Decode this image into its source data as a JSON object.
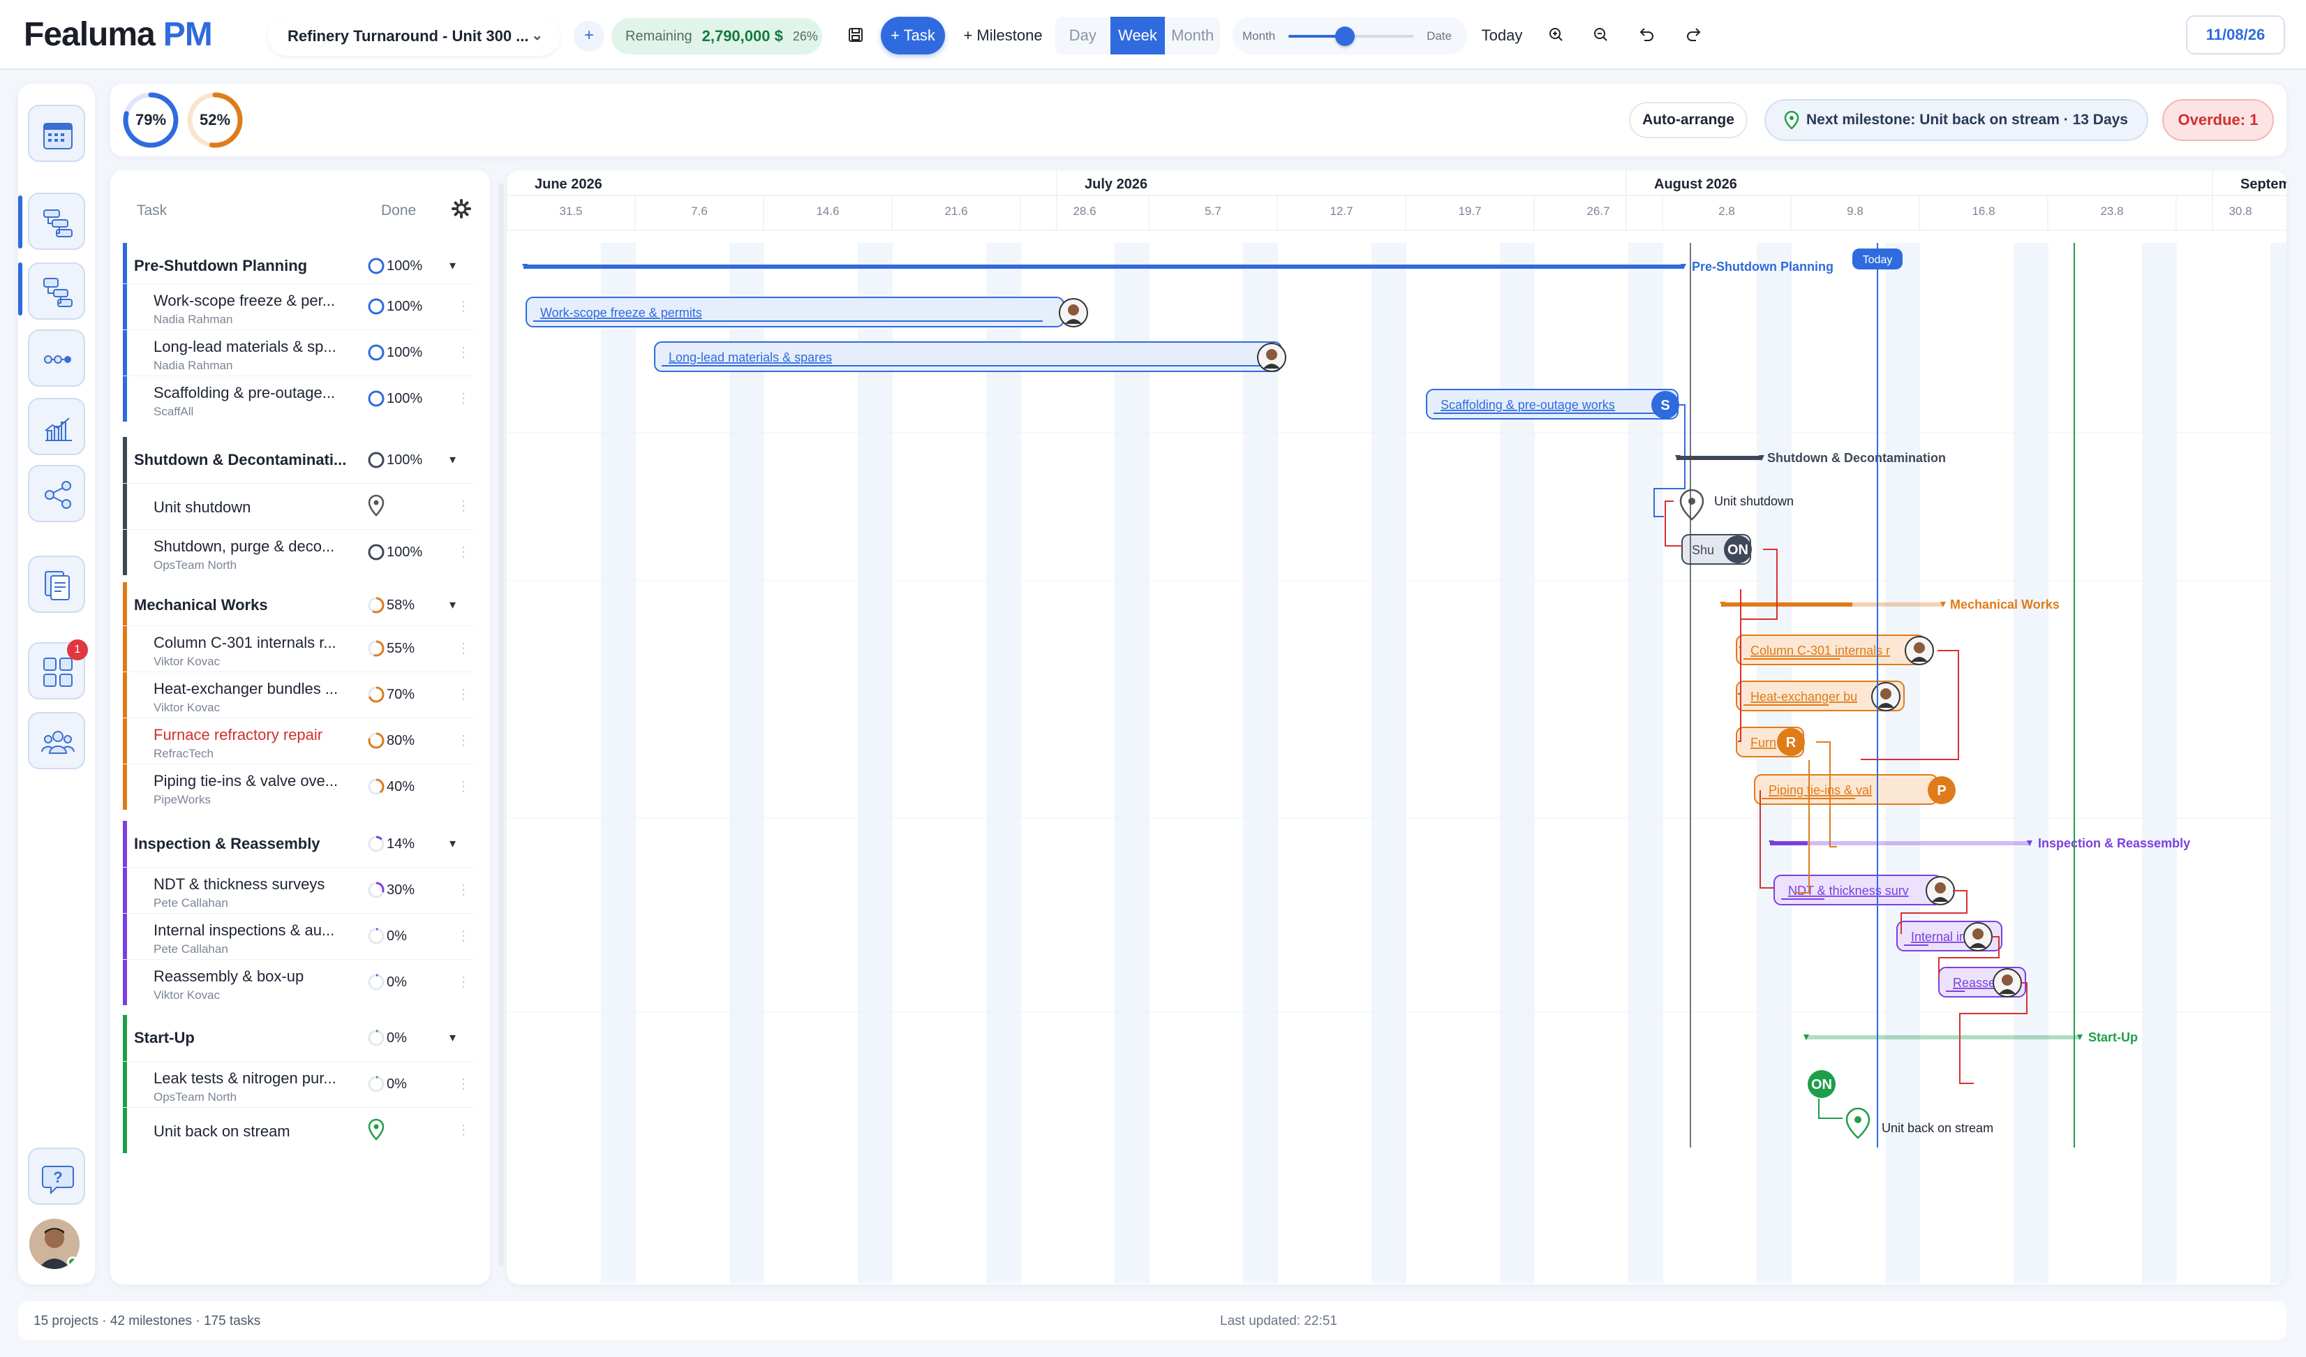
{
  "app": {
    "logo_main": "Fealuma",
    "logo_suffix": "PM"
  },
  "topbar": {
    "project": "Refinery Turnaround - Unit 300 ...",
    "remaining_label": "Remaining",
    "remaining_amount": "2,790,000 $",
    "remaining_pct": "26%",
    "task_btn": "+ Task",
    "milestone_btn": "+ Milestone",
    "views": [
      "Day",
      "Week",
      "Month"
    ],
    "active_view": "Week",
    "zoom_left": "Month",
    "zoom_right": "Date",
    "zoom_value": 0.45,
    "today_btn": "Today",
    "date": "11/08/26"
  },
  "stats": {
    "ring1": {
      "label": "79%",
      "value": 0.79,
      "color": "#2f6bde"
    },
    "ring2": {
      "label": "52%",
      "value": 0.52,
      "color": "#e07b1a"
    },
    "auto_arrange": "Auto-arrange",
    "next_milestone": "Next milestone: Unit back on stream · 13 Days",
    "overdue": "Overdue: 1"
  },
  "table": {
    "col_task": "Task",
    "col_done": "Done",
    "groups": [
      {
        "name": "Pre-Shutdown Planning",
        "pct": "100%",
        "value": 1.0,
        "color": "#2f6bde",
        "tasks": [
          {
            "name": "Work-scope freeze & permits",
            "short": "Work-scope freeze & per...",
            "owner": "Nadia Rahman",
            "pct": "100%",
            "value": 1.0
          },
          {
            "name": "Long-lead materials & spares",
            "short": "Long-lead materials & sp...",
            "owner": "Nadia Rahman",
            "pct": "100%",
            "value": 1.0
          },
          {
            "name": "Scaffolding & pre-outage works",
            "short": "Scaffolding & pre-outage...",
            "owner": "ScaffAll",
            "pct": "100%",
            "value": 1.0
          }
        ]
      },
      {
        "name": "Shutdown & Decontamination",
        "short": "Shutdown & Decontaminati...",
        "pct": "100%",
        "value": 1.0,
        "color": "#3f4858",
        "tasks": [
          {
            "name": "Unit shutdown",
            "short": "Unit shutdown",
            "owner": "",
            "pct": "",
            "milestone": true
          },
          {
            "name": "Shutdown, purge & decontamination",
            "short": "Shutdown, purge & deco...",
            "owner": "OpsTeam North",
            "pct": "100%",
            "value": 1.0
          }
        ]
      },
      {
        "name": "Mechanical Works",
        "pct": "58%",
        "value": 0.58,
        "color": "#e07b1a",
        "tasks": [
          {
            "name": "Column C-301 internals",
            "short": "Column C-301 internals r...",
            "owner": "Viktor Kovac",
            "pct": "55%",
            "value": 0.55
          },
          {
            "name": "Heat-exchanger bundles",
            "short": "Heat-exchanger bundles ...",
            "owner": "Viktor Kovac",
            "pct": "70%",
            "value": 0.7
          },
          {
            "name": "Furnace refractory repair",
            "short": "Furnace refractory repair",
            "owner": "RefracTech",
            "pct": "80%",
            "value": 0.8,
            "overdue": true
          },
          {
            "name": "Piping tie-ins & valve overhaul",
            "short": "Piping tie-ins & valve ove...",
            "owner": "PipeWorks",
            "pct": "40%",
            "value": 0.4
          }
        ]
      },
      {
        "name": "Inspection & Reassembly",
        "pct": "14%",
        "value": 0.14,
        "color": "#7b3fe0",
        "tasks": [
          {
            "name": "NDT & thickness surveys",
            "short": "NDT & thickness surveys",
            "owner": "Pete Callahan",
            "pct": "30%",
            "value": 0.3
          },
          {
            "name": "Internal inspections & audits",
            "short": "Internal inspections & au...",
            "owner": "Pete Callahan",
            "pct": "0%",
            "value": 0
          },
          {
            "name": "Reassembly & box-up",
            "short": "Reassembly & box-up",
            "owner": "Viktor Kovac",
            "pct": "0%",
            "value": 0
          }
        ]
      },
      {
        "name": "Start-Up",
        "pct": "0%",
        "value": 0,
        "color": "#1e9e48",
        "tasks": [
          {
            "name": "Leak tests & nitrogen purge",
            "short": "Leak tests & nitrogen pur...",
            "owner": "OpsTeam North",
            "pct": "0%",
            "value": 0
          },
          {
            "name": "Unit back on stream",
            "short": "Unit back on stream",
            "owner": "",
            "pct": "",
            "milestone": true
          }
        ]
      }
    ]
  },
  "timeline": {
    "months": [
      "June 2026",
      "July 2026",
      "August 2026",
      "Septemb"
    ],
    "weeks": [
      "31.5",
      "7.6",
      "14.6",
      "21.6",
      "28.6",
      "5.7",
      "12.7",
      "19.7",
      "26.7",
      "2.8",
      "9.8",
      "16.8",
      "23.8",
      "30.8"
    ],
    "today_label": "Today",
    "bars": {
      "g1_label": "Pre-Shutdown Planning",
      "t1": "Work-scope freeze & permits",
      "t2": "Long-lead materials & spares",
      "t3": "Scaffolding & pre-outage works",
      "t3_badge": "S",
      "g2_label": "Shutdown & Decontamination",
      "m1": "Unit shutdown",
      "t5": "Shutdown, purge & decontamination",
      "t5_vis": "Shu",
      "t5_badge": "ON",
      "g3_label": "Mechanical Works",
      "t6_vis": "Column C-301 internals r",
      "t7_vis": "Heat-exchanger bu",
      "t8_vis": "Furn",
      "t8_badge": "R",
      "t9_vis": "Piping tie-ins & val",
      "t9_badge": "P",
      "g4_label": "Inspection & Reassembly",
      "t10_vis": "NDT & thickness surv",
      "t11_vis": "Internal in",
      "t12_vis": "Reasse",
      "g5_label": "Start-Up",
      "t13_badge": "ON",
      "m2": "Unit back on stream"
    }
  },
  "footer": {
    "summary": "15 projects · 42 milestones · 175 tasks",
    "updated": "Last updated: 22:51"
  }
}
